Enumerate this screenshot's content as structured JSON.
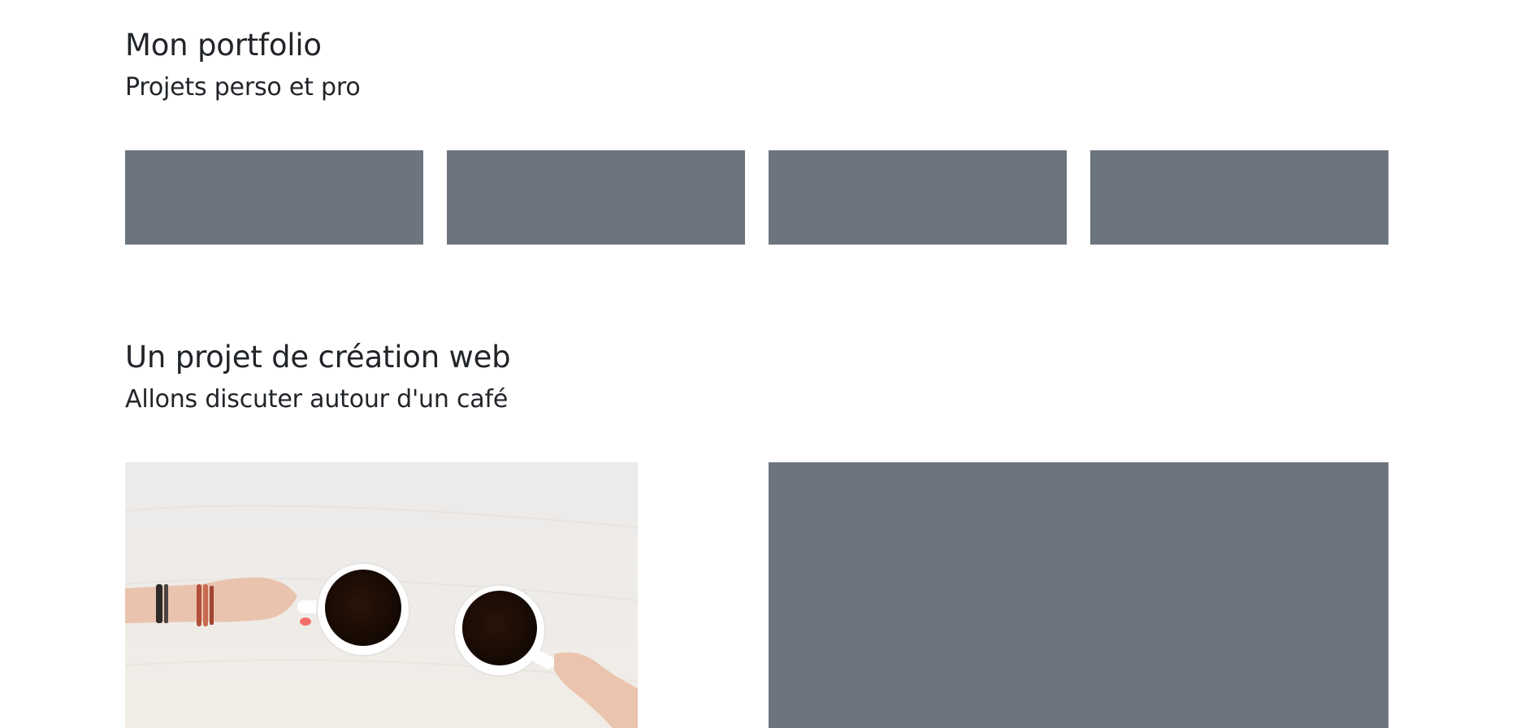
{
  "portfolio": {
    "title": "Mon portfolio",
    "subtitle": "Projets perso et pro",
    "thumbnails": [
      {
        "color": "#6c757d"
      },
      {
        "color": "#6c757d"
      },
      {
        "color": "#6c757d"
      },
      {
        "color": "#6c757d"
      }
    ]
  },
  "project": {
    "title": "Un projet de création web",
    "subtitle": "Allons discuter autour d'un café",
    "photo": {
      "icon": "coffee-cups-photo"
    },
    "placeholder": {
      "color": "#6c757d"
    }
  },
  "colors": {
    "text": "#212529",
    "placeholder": "#6c757d",
    "background": "#ffffff"
  }
}
